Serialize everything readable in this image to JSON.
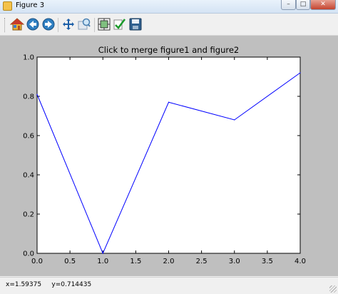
{
  "window": {
    "title": "Figure 3",
    "buttons": {
      "minimize": "–",
      "maximize": "□",
      "close": "✕"
    }
  },
  "toolbar": {
    "items": [
      {
        "name": "home-icon",
        "tooltip": "Home"
      },
      {
        "name": "back-icon",
        "tooltip": "Back"
      },
      {
        "name": "forward-icon",
        "tooltip": "Forward"
      },
      {
        "name": "pan-icon",
        "tooltip": "Pan"
      },
      {
        "name": "zoom-icon",
        "tooltip": "Zoom"
      },
      {
        "name": "subplots-icon",
        "tooltip": "Subplots"
      },
      {
        "name": "edit-check-icon",
        "tooltip": "Customize"
      },
      {
        "name": "save-icon",
        "tooltip": "Save"
      }
    ]
  },
  "status": {
    "coords": "x=1.59375     y=0.714435"
  },
  "colors": {
    "line": "#0000ff",
    "figure_bg": "#bfbfbf",
    "axes_bg": "#ffffff"
  },
  "chart_data": {
    "type": "line",
    "title": "Click to merge figure1 and figure2",
    "xlabel": "",
    "ylabel": "",
    "x": [
      0,
      1,
      2,
      3,
      4
    ],
    "series": [
      {
        "values": [
          0.81,
          0.0,
          0.77,
          0.68,
          0.92
        ]
      }
    ],
    "xlim": [
      0,
      4
    ],
    "ylim": [
      0,
      1
    ],
    "xticks": [
      "0.0",
      "0.5",
      "1.0",
      "1.5",
      "2.0",
      "2.5",
      "3.0",
      "3.5",
      "4.0"
    ],
    "yticks": [
      "0.0",
      "0.2",
      "0.4",
      "0.6",
      "0.8",
      "1.0"
    ],
    "grid": false,
    "legend": "none"
  }
}
